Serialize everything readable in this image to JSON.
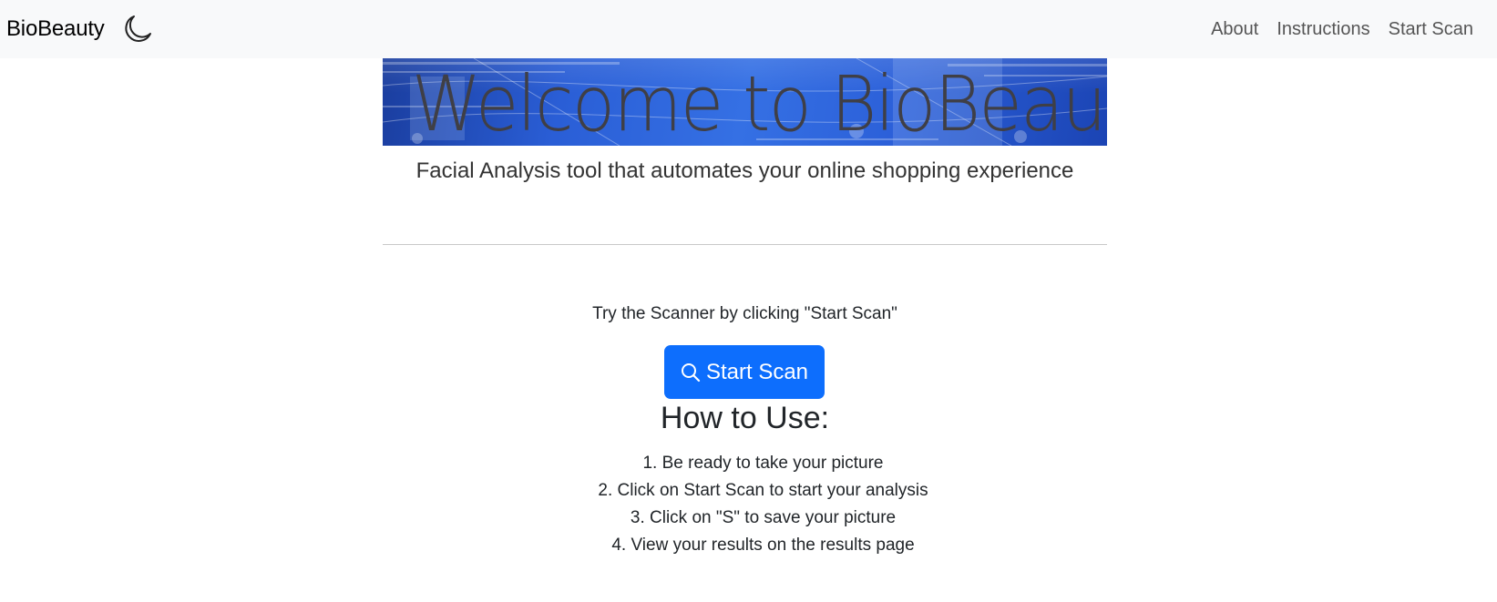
{
  "navbar": {
    "brand": "BioBeauty",
    "theme_toggle_icon": "moon-icon",
    "links": [
      {
        "label": "About"
      },
      {
        "label": "Instructions"
      },
      {
        "label": "Start Scan"
      }
    ]
  },
  "hero": {
    "title": "Welcome to BioBeauty",
    "subtitle": "Facial Analysis tool that automates your online shopping experience"
  },
  "main": {
    "prompt": "Try the Scanner by clicking \"Start Scan\"",
    "scan_button": {
      "label": "Start Scan",
      "icon": "search-icon"
    },
    "how_to_title": "How to Use:",
    "steps": [
      "1. Be ready to take your picture",
      "2. Click on Start Scan to start your analysis",
      "3. Click on \"S\" to save your picture",
      "4. View your results on the results page"
    ]
  },
  "colors": {
    "navbar_bg": "#f8f9fa",
    "button_primary": "#0d6efd",
    "banner_blue": "#2a5ed6"
  }
}
